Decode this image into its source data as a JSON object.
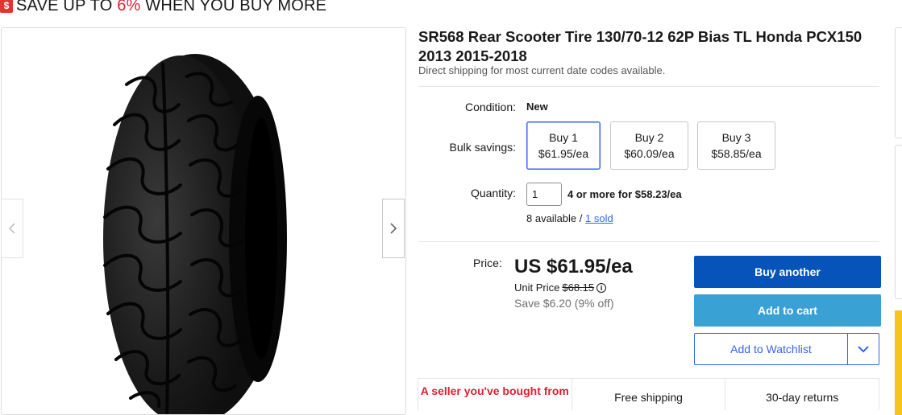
{
  "promo": {
    "icon": "$",
    "prefix": "SAVE UP TO ",
    "percent": "6%",
    "suffix": " WHEN YOU BUY MORE",
    "accent_color": "#dd1e31"
  },
  "listing": {
    "title": "SR568 Rear Scooter Tire 130/70-12 62P Bias TL Honda PCX150 2013 2015-2018",
    "subtitle": "Direct shipping for most current date codes available."
  },
  "condition": {
    "label": "Condition:",
    "value": "New"
  },
  "bulk": {
    "label": "Bulk savings:",
    "options": [
      {
        "qty": "Buy 1",
        "price": "$61.95/ea",
        "selected": true
      },
      {
        "qty": "Buy 2",
        "price": "$60.09/ea",
        "selected": false
      },
      {
        "qty": "Buy 3",
        "price": "$58.85/ea",
        "selected": false
      }
    ]
  },
  "quantity": {
    "label": "Quantity:",
    "value": "1",
    "offer": "4 or more for $58.23/ea",
    "available": "8 available / ",
    "sold": "1 sold"
  },
  "price": {
    "label": "Price:",
    "main": "US $61.95/ea",
    "unit_label": "Unit Price ",
    "unit_old": "$68.15",
    "save": "Save $6.20 (9% off)"
  },
  "actions": {
    "buy": "Buy another",
    "cart": "Add to cart",
    "watch": "Add to Watchlist"
  },
  "features": {
    "seller": "A seller you've bought from",
    "shipping": "Free shipping",
    "returns": "30-day returns"
  },
  "colors": {
    "buy_button": "#0654ba",
    "cart_button": "#3aa1d5",
    "link": "#3665f3"
  }
}
